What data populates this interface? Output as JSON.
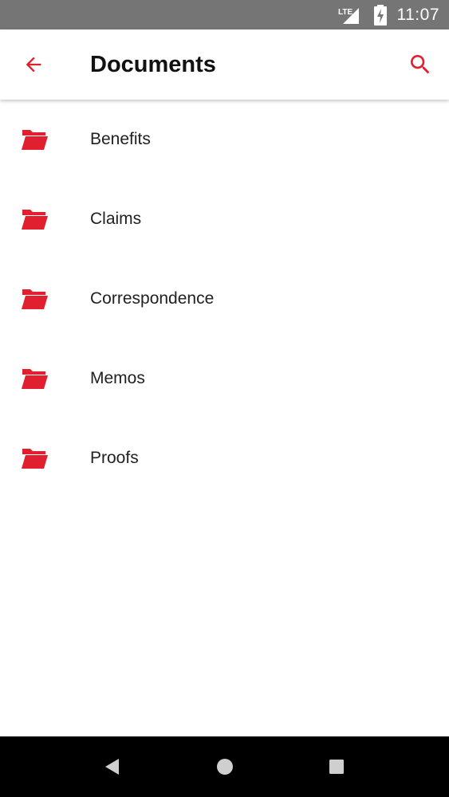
{
  "status_bar": {
    "network_label": "LTE",
    "time": "11:07"
  },
  "app_bar": {
    "title": "Documents",
    "back_icon": "arrow-back-icon",
    "search_icon": "search-icon"
  },
  "documents": [
    {
      "label": "Benefits",
      "icon": "folder-icon"
    },
    {
      "label": "Claims",
      "icon": "folder-icon"
    },
    {
      "label": "Correspondence",
      "icon": "folder-icon"
    },
    {
      "label": "Memos",
      "icon": "folder-icon"
    },
    {
      "label": "Proofs",
      "icon": "folder-icon"
    }
  ],
  "nav_bar": {
    "back_icon": "nav-back-icon",
    "home_icon": "nav-home-icon",
    "recents_icon": "nav-recents-icon"
  },
  "colors": {
    "accent": "#e0202e",
    "status_bar": "#757575",
    "nav_bar": "#000000"
  }
}
